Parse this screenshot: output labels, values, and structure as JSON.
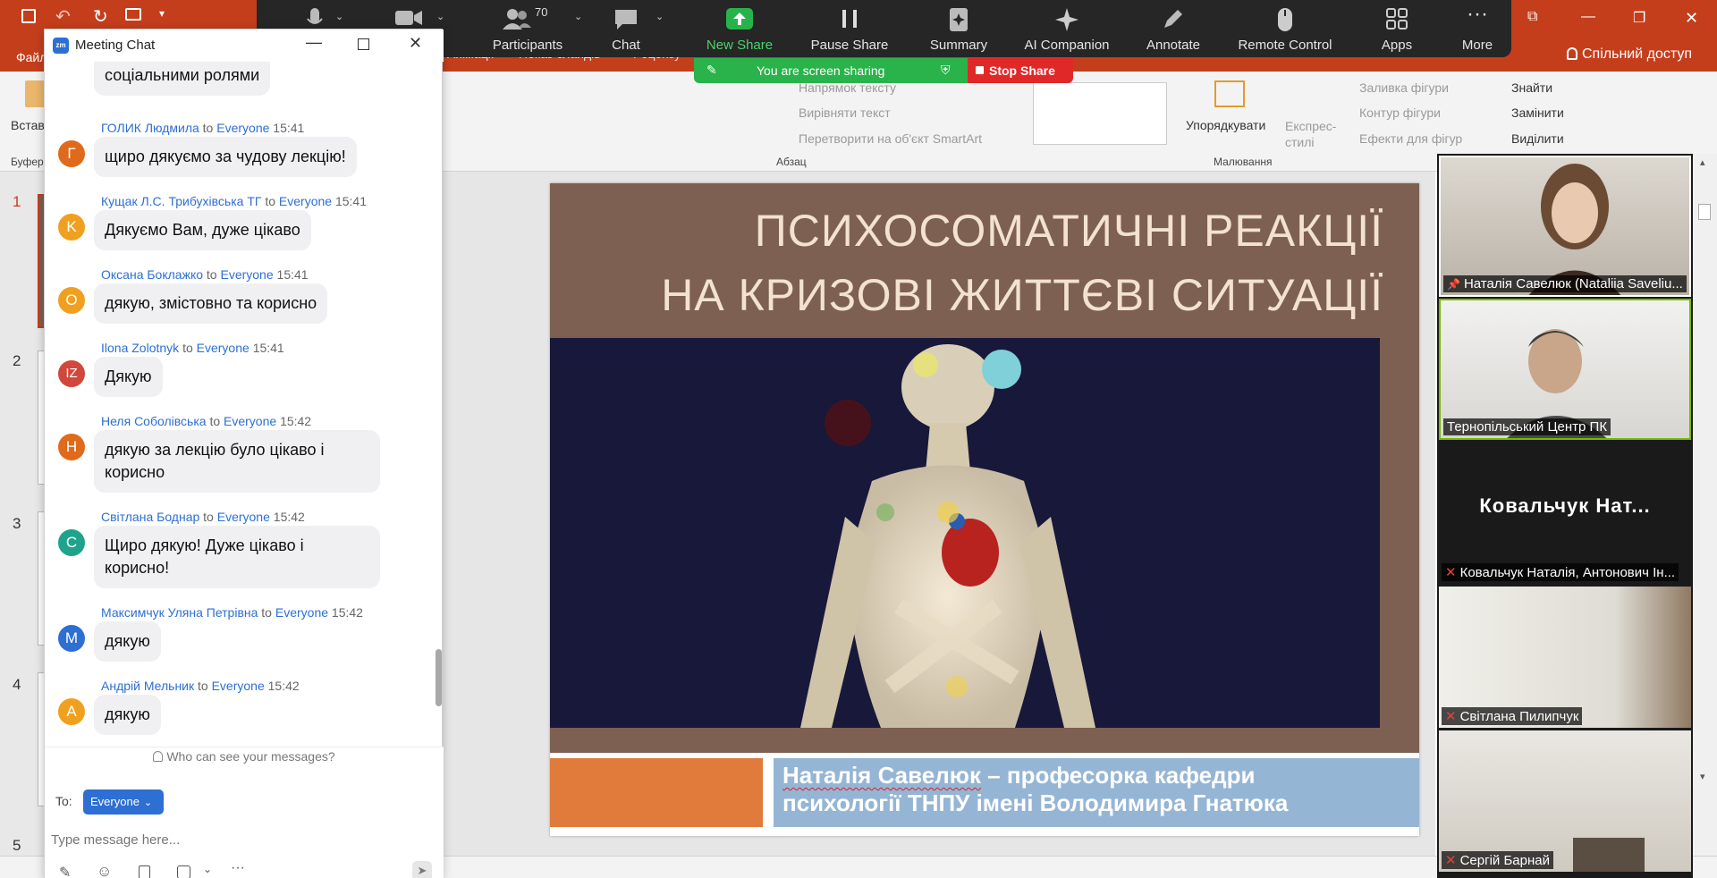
{
  "ppt": {
    "menu": {
      "file": "Файл",
      "animations": "Анімації",
      "slideshow": "Показ слайдів",
      "review": "Рецензу"
    },
    "ribbon": {
      "insert": "Встав",
      "buffer": "Буфер",
      "text_direction": "Напрямок тексту",
      "align_text": "Вирівняти текст",
      "convert_smartart": "Перетворити на об'єкт SmartArt",
      "paragraph_group": "Абзац",
      "arrange": "Упорядкувати",
      "quick_styles": "Експрес-стилі",
      "shape_fill": "Заливка фігури",
      "shape_outline": "Контур фігури",
      "shape_effects": "Ефекти для фігур",
      "drawing_group": "Малювання",
      "find": "Знайти",
      "replace": "Замінити",
      "select": "Виділити"
    },
    "share_doc": "Спільний доступ",
    "slide_numbers": [
      "1",
      "2",
      "3",
      "4",
      "5"
    ]
  },
  "slide": {
    "title_line1": "ПСИХОСОМАТИЧНІ РЕАКЦІЇ",
    "title_line2": "НА КРИЗОВІ ЖИТТЄВІ СИТУАЦІЇ",
    "caption_line1_name": "Наталія Савелюк",
    "caption_line1_rest": " – професорка кафедри",
    "caption_line2": "психології ТНПУ імені Володимира Гнатюка"
  },
  "zoom": {
    "participants_count": "70",
    "toolbar": {
      "participants": "Participants",
      "chat": "Chat",
      "new_share": "New Share",
      "pause_share": "Pause Share",
      "summary": "Summary",
      "ai_companion": "AI Companion",
      "annotate": "Annotate",
      "remote_control": "Remote Control",
      "apps": "Apps",
      "more": "More"
    },
    "share_banner": "You are screen sharing",
    "stop_share": "Stop Share"
  },
  "chat": {
    "title": "Meeting Chat",
    "top_partial": "соціальними ролями",
    "messages": [
      {
        "avatar": "Г",
        "color": "#e06a1b",
        "name": "ГОЛИК Людмила",
        "to": "to",
        "target": "Everyone",
        "time": "15:41",
        "text": "щиро дякуємо за чудову лекцію!"
      },
      {
        "avatar": "K",
        "color": "#f0a020",
        "name": "Кущак Л.С. Трибухівська ТГ",
        "to": "to",
        "target": "Everyone",
        "time": "15:41",
        "text": "Дякуємо Вам, дуже цікаво"
      },
      {
        "avatar": "O",
        "color": "#f0a020",
        "name": "Оксана Боклажко",
        "to": "to",
        "target": "Everyone",
        "time": "15:41",
        "text": "дякую, змістовно та корисно"
      },
      {
        "avatar": "IZ",
        "color": "#d2473b",
        "name": "Ilona Zolotnyk",
        "to": "to",
        "target": "Everyone",
        "time": "15:41",
        "text": "Дякую"
      },
      {
        "avatar": "H",
        "color": "#e06a1b",
        "name": "Неля Соболівська",
        "to": "to",
        "target": "Everyone",
        "time": "15:42",
        "text": "дякую за лекцію було цікаво і корисно"
      },
      {
        "avatar": "С",
        "color": "#1fa38a",
        "name": "Світлана Боднар",
        "to": "to",
        "target": "Everyone",
        "time": "15:42",
        "text": "Щиро дякую! Дуже цікаво і корисно!"
      },
      {
        "avatar": "M",
        "color": "#2d6fd3",
        "name": "Максимчук Уляна Петрівна",
        "to": "to",
        "target": "Everyone",
        "time": "15:42",
        "text": "дякую"
      },
      {
        "avatar": "A",
        "color": "#f0a020",
        "name": "Андрій Мельник",
        "to": "to",
        "target": "Everyone",
        "time": "15:42",
        "text": "дякую"
      }
    ],
    "who_can_see": "Who can see your messages?",
    "to_label": "To:",
    "recipient": "Everyone",
    "input_placeholder": "Type message here..."
  },
  "gallery": {
    "participants": [
      {
        "name": "Наталія Савелюк (Nataliia Saveliu..."
      },
      {
        "name": "Тернопільський Центр ПК"
      },
      {
        "name": "Ковальчук Наталія, Антонович Ін...",
        "big_name": "Ковальчук Нат..."
      },
      {
        "name": "Світлана Пилипчук"
      },
      {
        "name": "Сергій Барнай"
      }
    ]
  }
}
